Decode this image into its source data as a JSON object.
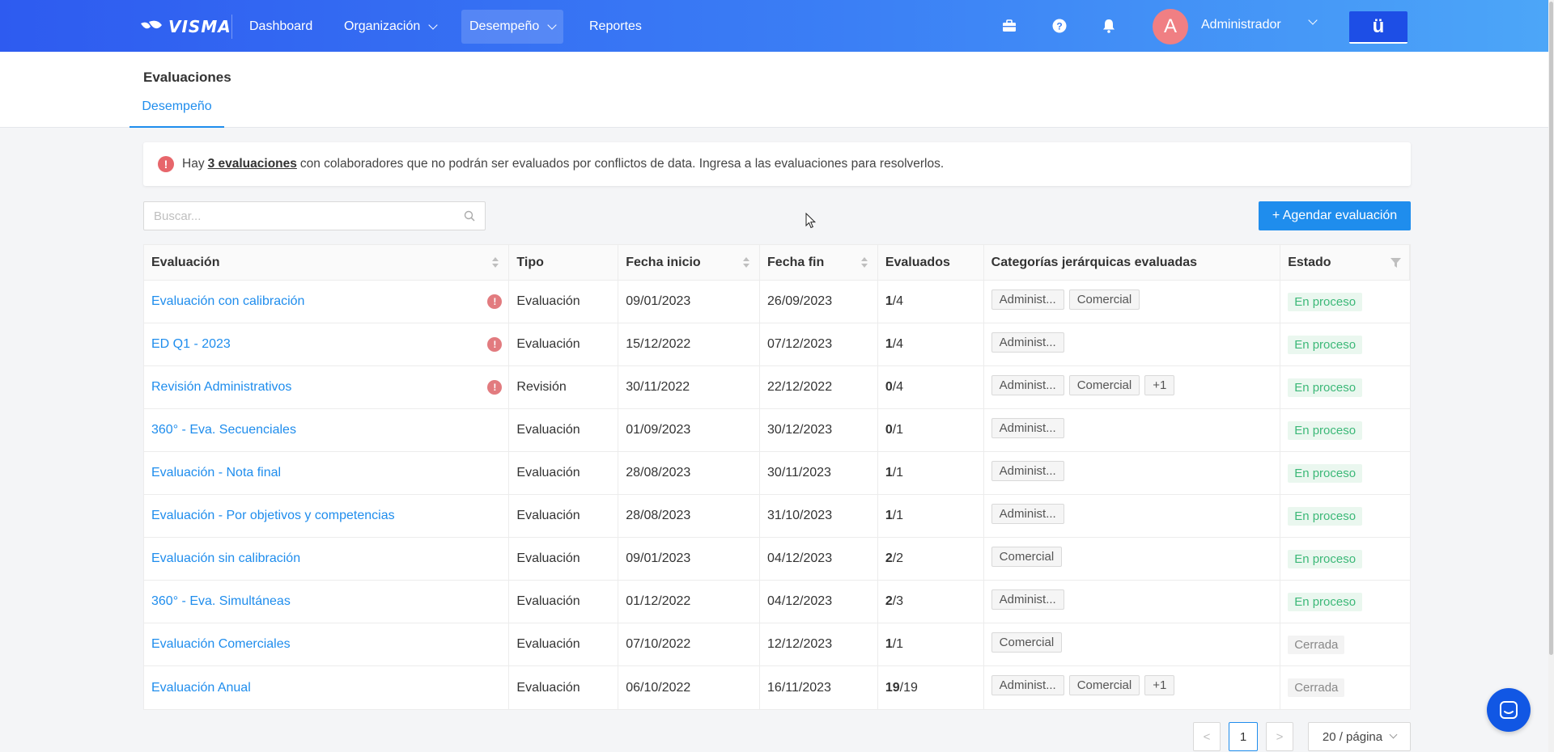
{
  "nav": {
    "logo": "VISMA",
    "items": [
      {
        "label": "Dashboard"
      },
      {
        "label": "Organización"
      },
      {
        "label": "Desempeño"
      },
      {
        "label": "Reportes"
      }
    ],
    "user": {
      "initial": "A",
      "name": "Administrador"
    },
    "u_button": "ü"
  },
  "header": {
    "title": "Evaluaciones",
    "tab": "Desempeño"
  },
  "alert": {
    "prefix": "Hay",
    "link": "3 evaluaciones",
    "suffix": "con colaboradores que no podrán ser evaluados por conflictos de data. Ingresa a las evaluaciones para resolverlos."
  },
  "search": {
    "placeholder": "Buscar..."
  },
  "add_button": "+ Agendar evaluación",
  "table": {
    "columns": [
      "Evaluación",
      "Tipo",
      "Fecha inicio",
      "Fecha fin",
      "Evaluados",
      "Categorías jerárquicas evaluadas",
      "Estado"
    ],
    "rows": [
      {
        "name": "Evaluación con calibración",
        "warn": true,
        "type": "Evaluación",
        "start": "09/01/2023",
        "end": "26/09/2023",
        "done": "1",
        "total": "/4",
        "tags": [
          "Administ...",
          "Comercial"
        ],
        "status": "En proceso"
      },
      {
        "name": "ED Q1 - 2023",
        "warn": true,
        "type": "Evaluación",
        "start": "15/12/2022",
        "end": "07/12/2023",
        "done": "1",
        "total": "/4",
        "tags": [
          "Administ..."
        ],
        "status": "En proceso"
      },
      {
        "name": "Revisión Administrativos",
        "warn": true,
        "type": "Revisión",
        "start": "30/11/2022",
        "end": "22/12/2022",
        "done": "0",
        "total": "/4",
        "tags": [
          "Administ...",
          "Comercial",
          "+1"
        ],
        "status": "En proceso"
      },
      {
        "name": "360° - Eva. Secuenciales",
        "warn": false,
        "type": "Evaluación",
        "start": "01/09/2023",
        "end": "30/12/2023",
        "done": "0",
        "total": "/1",
        "tags": [
          "Administ..."
        ],
        "status": "En proceso"
      },
      {
        "name": "Evaluación - Nota final",
        "warn": false,
        "type": "Evaluación",
        "start": "28/08/2023",
        "end": "30/11/2023",
        "done": "1",
        "total": "/1",
        "tags": [
          "Administ..."
        ],
        "status": "En proceso"
      },
      {
        "name": "Evaluación - Por objetivos y competencias",
        "warn": false,
        "type": "Evaluación",
        "start": "28/08/2023",
        "end": "31/10/2023",
        "done": "1",
        "total": "/1",
        "tags": [
          "Administ..."
        ],
        "status": "En proceso"
      },
      {
        "name": "Evaluación sin calibración",
        "warn": false,
        "type": "Evaluación",
        "start": "09/01/2023",
        "end": "04/12/2023",
        "done": "2",
        "total": "/2",
        "tags": [
          "Comercial"
        ],
        "status": "En proceso"
      },
      {
        "name": "360° - Eva. Simultáneas",
        "warn": false,
        "type": "Evaluación",
        "start": "01/12/2022",
        "end": "04/12/2023",
        "done": "2",
        "total": "/3",
        "tags": [
          "Administ..."
        ],
        "status": "En proceso"
      },
      {
        "name": "Evaluación Comerciales",
        "warn": false,
        "type": "Evaluación",
        "start": "07/10/2022",
        "end": "12/12/2023",
        "done": "1",
        "total": "/1",
        "tags": [
          "Comercial"
        ],
        "status": "Cerrada"
      },
      {
        "name": "Evaluación Anual",
        "warn": false,
        "type": "Evaluación",
        "start": "06/10/2022",
        "end": "16/11/2023",
        "done": "19",
        "total": "/19",
        "tags": [
          "Administ...",
          "Comercial",
          "+1"
        ],
        "status": "Cerrada"
      }
    ]
  },
  "pagination": {
    "prev": "<",
    "current": "1",
    "next": ">",
    "page_size": "20 / página"
  },
  "colors": {
    "accent": "#1f8ded",
    "nav_start": "#2e5bf0",
    "nav_end": "#4ca6f8",
    "warning": "#e7666b",
    "status_active": "#3cb878"
  }
}
